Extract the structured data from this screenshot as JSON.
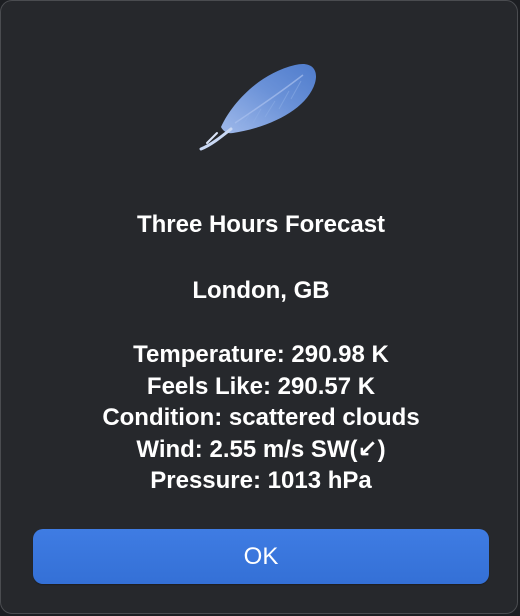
{
  "dialog": {
    "icon": "feather-icon",
    "title": "Three Hours Forecast",
    "location": "London, GB",
    "details": [
      "Temperature: 290.98 K",
      "Feels Like: 290.57 K",
      "Condition: scattered clouds",
      "Wind: 2.55 m/s SW(↙)",
      "Pressure: 1013 hPa"
    ],
    "ok_label": "OK"
  },
  "colors": {
    "background": "#26282c",
    "button": "#3a76dd",
    "text": "#ffffff",
    "feather": "#6f94d6"
  }
}
